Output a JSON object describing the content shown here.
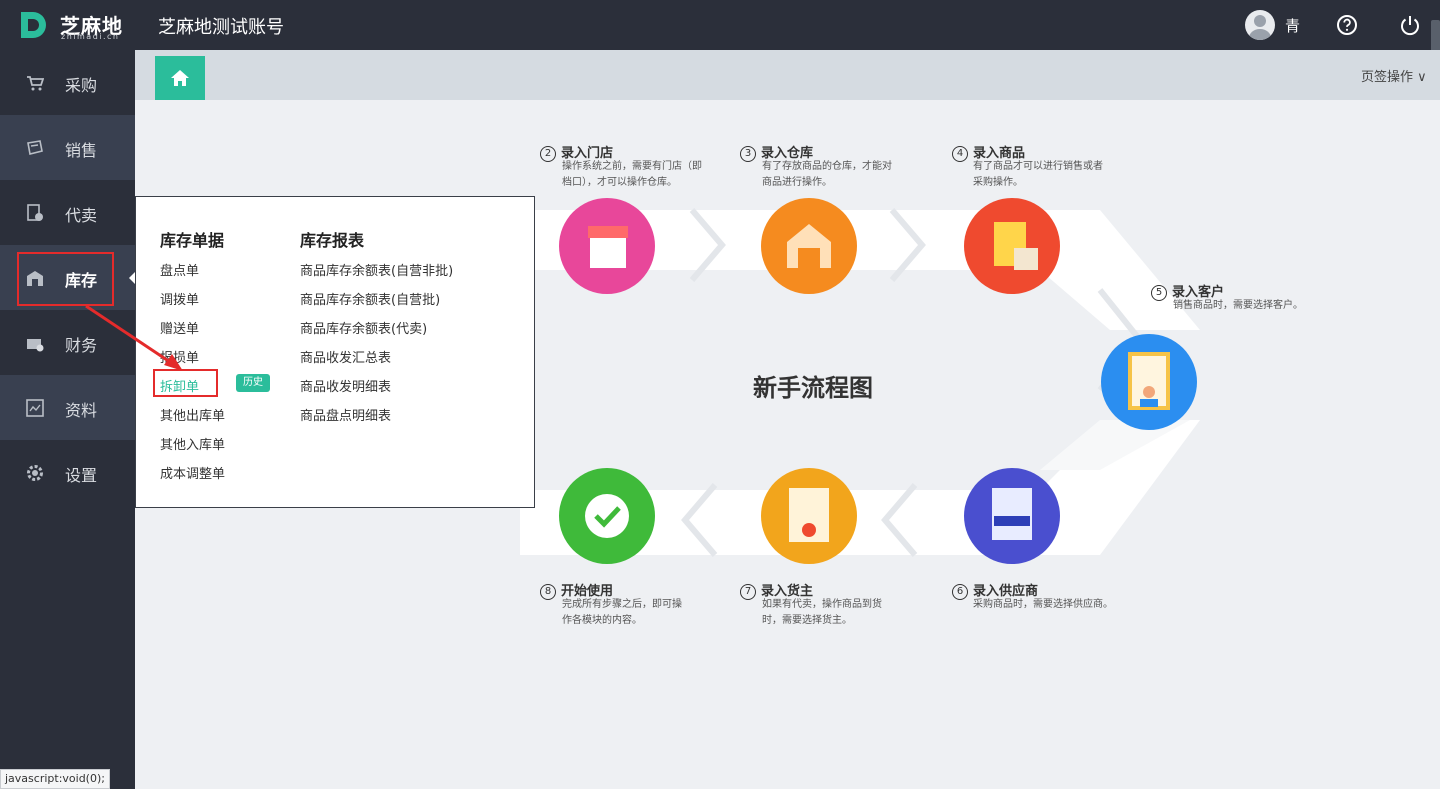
{
  "app": {
    "logo_text": "芝麻地",
    "logo_sub": "zhimadi.cn",
    "account_title": "芝麻地测试账号",
    "user_name": "青"
  },
  "icons": {
    "help": "help-circle-icon",
    "power": "power-icon",
    "home": "home-icon"
  },
  "colors": {
    "accent": "#2bbd9b",
    "highlight": "#e42b2b",
    "sidebar": "#2b2f3a"
  },
  "sidebar": {
    "items": [
      {
        "label": "采购",
        "icon": "cart-icon"
      },
      {
        "label": "销售",
        "icon": "sale-icon"
      },
      {
        "label": "代卖",
        "icon": "consign-icon"
      },
      {
        "label": "库存",
        "icon": "warehouse-icon"
      },
      {
        "label": "财务",
        "icon": "finance-icon"
      },
      {
        "label": "资料",
        "icon": "profile-icon"
      },
      {
        "label": "设置",
        "icon": "gear-icon"
      }
    ]
  },
  "tabs": {
    "ops_label": "页签操作 ∨"
  },
  "menu": {
    "docs_title": "库存单据",
    "docs": [
      "盘点单",
      "调拨单",
      "赠送单",
      "报损单",
      "拆卸单",
      "其他出库单",
      "其他入库单",
      "成本调整单"
    ],
    "history_badge": "历史",
    "reports_title": "库存报表",
    "reports": [
      "商品库存余额表(自营非批)",
      "商品库存余额表(自营批)",
      "商品库存余额表(代卖)",
      "商品收发汇总表",
      "商品收发明细表",
      "商品盘点明细表"
    ]
  },
  "flow": {
    "title": "新手流程图",
    "steps": [
      {
        "num": "2",
        "title": "录入门店",
        "desc1": "操作系统之前，需要有门店（即",
        "desc2": "档口），才可以操作仓库。",
        "color": "#e8479a"
      },
      {
        "num": "3",
        "title": "录入仓库",
        "desc1": "有了存放商品的仓库，才能对",
        "desc2": "商品进行操作。",
        "color": "#f58b1f"
      },
      {
        "num": "4",
        "title": "录入商品",
        "desc1": "有了商品才可以进行销售或者",
        "desc2": "采购操作。",
        "color": "#ef4a2f"
      },
      {
        "num": "5",
        "title": "录入客户",
        "desc1": "销售商品时，需要选择客户。",
        "desc2": "",
        "color": "#2b8ef0"
      },
      {
        "num": "6",
        "title": "录入供应商",
        "desc1": "采购商品时，需要选择供应商。",
        "desc2": "",
        "color": "#4a4fcf"
      },
      {
        "num": "7",
        "title": "录入货主",
        "desc1": "如果有代卖，操作商品到货",
        "desc2": "时，需要选择货主。",
        "color": "#f2a51c"
      },
      {
        "num": "8",
        "title": "开始使用",
        "desc1": "完成所有步骤之后，即可操",
        "desc2": "作各模块的内容。",
        "color": "#3fba3a"
      }
    ]
  },
  "status_bar": "javascript:void(0);"
}
